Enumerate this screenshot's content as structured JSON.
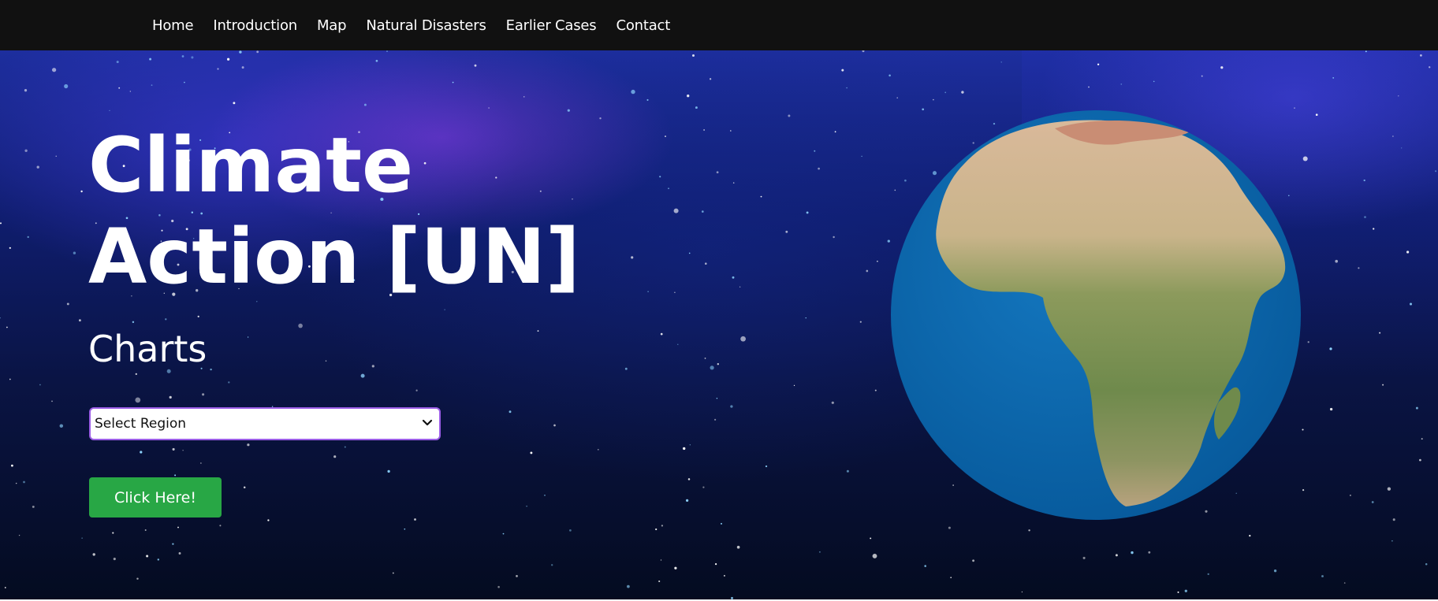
{
  "nav": {
    "items": [
      {
        "label": "Home"
      },
      {
        "label": "Introduction"
      },
      {
        "label": "Map"
      },
      {
        "label": "Natural Disasters"
      },
      {
        "label": "Earlier Cases"
      },
      {
        "label": "Contact"
      }
    ]
  },
  "hero": {
    "title": "Climate Action [UN]",
    "subtitle": "Charts",
    "region_select": {
      "selected": "Select Region",
      "icon": "chevron-down-icon"
    },
    "button_label": "Click Here!",
    "globe_icon": "earth-globe-icon"
  },
  "colors": {
    "navbar_bg": "#111111",
    "button_green": "#28a745",
    "select_border": "#9b5de5",
    "ocean": "#0d67ae",
    "space_dark": "#040b20"
  }
}
